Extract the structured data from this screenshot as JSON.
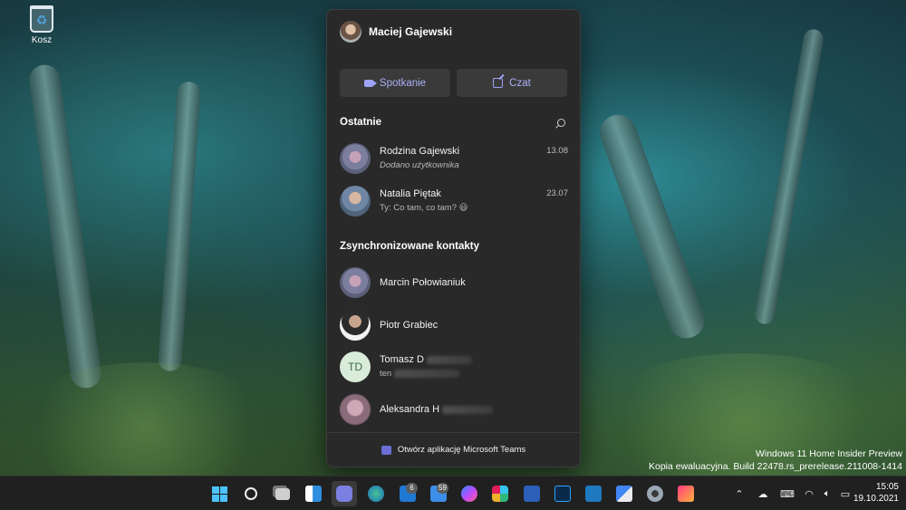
{
  "desktop": {
    "recycle_bin_label": "Kosz",
    "watermark_line1": "Windows 11 Home Insider Preview",
    "watermark_line2": "Kopia ewaluacyjna. Build 22478.rs_prerelease.211008-1414"
  },
  "teams": {
    "user_name": "Maciej Gajewski",
    "meet_label": "Spotkanie",
    "chat_label": "Czat",
    "recent_title": "Ostatnie",
    "recent": [
      {
        "name": "Rodzina Gajewski",
        "preview": "Dodano użytkownika",
        "date": "13.08"
      },
      {
        "name": "Natalia Piętak",
        "preview": "Ty: Co tam, co tam? 😃",
        "date": "23.07"
      }
    ],
    "contacts_title": "Zsynchronizowane kontakty",
    "contacts": [
      {
        "name": "Marcin Połowianiuk"
      },
      {
        "name": "Piotr Grabiec"
      },
      {
        "name": "Tomasz D",
        "initials": "TD",
        "sub": "ten"
      },
      {
        "name": "Aleksandra H"
      }
    ],
    "footer_label": "Otwórz aplikację Microsoft Teams",
    "accent": "#9ea4f5"
  },
  "taskbar": {
    "mail_badge": "6",
    "todo_badge": "59",
    "time": "15:05",
    "date": "19.10.2021"
  }
}
